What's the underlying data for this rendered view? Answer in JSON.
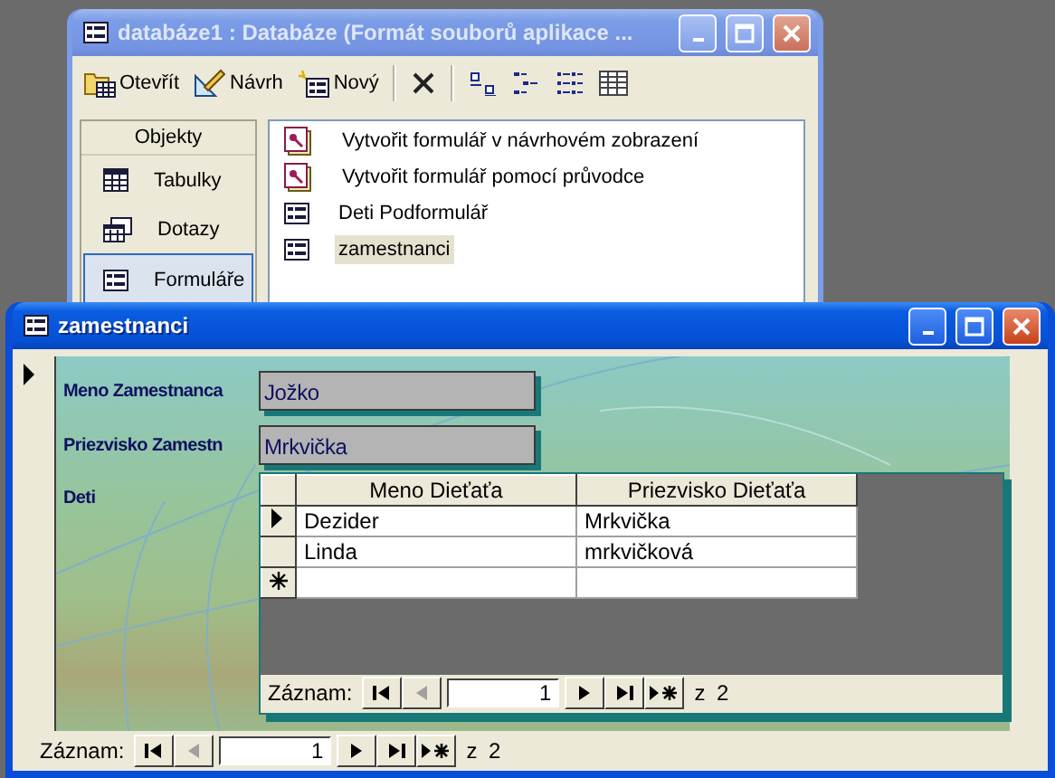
{
  "db_window": {
    "title": "databáze1 : Databáze (Formát souborů aplikace ...",
    "active": false,
    "toolbar": [
      {
        "kind": "open",
        "label": "Otevřít"
      },
      {
        "kind": "design",
        "label": "Návrh"
      },
      {
        "kind": "new",
        "label": "Nový"
      },
      {
        "kind": "delete"
      },
      {
        "kind": "large-icons"
      },
      {
        "kind": "small-icons"
      },
      {
        "kind": "list"
      },
      {
        "kind": "details"
      }
    ],
    "objects_header": "Objekty",
    "objects": [
      {
        "kind": "table",
        "label": "Tabulky",
        "selected": false
      },
      {
        "kind": "query",
        "label": "Dotazy",
        "selected": false
      },
      {
        "kind": "form",
        "label": "Formuláře",
        "selected": true
      }
    ],
    "items": [
      {
        "kind": "wizard",
        "label": "Vytvořit formulář v návrhovém zobrazení",
        "selected": false
      },
      {
        "kind": "wizard",
        "label": "Vytvořit formulář pomocí průvodce",
        "selected": false
      },
      {
        "kind": "form",
        "label": "Deti Podformulář",
        "selected": false
      },
      {
        "kind": "form",
        "label": "zamestnanci",
        "selected": true
      }
    ]
  },
  "form_window": {
    "title": "zamestnanci",
    "active": true,
    "fields": [
      {
        "label": "Meno Zamestnanca",
        "value": "Jožko"
      },
      {
        "label": "Priezvisko Zamestn",
        "value": "Mrkvička"
      }
    ],
    "subform": {
      "label": "Deti",
      "columns": [
        "Meno Dieťaťa",
        "Priezvisko Dieťaťa"
      ],
      "rows": [
        {
          "kind": "current",
          "cells": [
            "Dezider",
            "Mrkvička"
          ]
        },
        {
          "kind": "plain",
          "cells": [
            "Linda",
            "mrkvičková"
          ]
        },
        {
          "kind": "new"
        }
      ],
      "navigation": {
        "label": "Záznam:",
        "of": "z 2",
        "controls": [
          {
            "kind": "first",
            "disabled": false
          },
          {
            "kind": "prev",
            "disabled": true
          },
          {
            "kind": "record",
            "value": "1"
          },
          {
            "kind": "next",
            "disabled": false
          },
          {
            "kind": "last",
            "disabled": false
          },
          {
            "kind": "new",
            "disabled": false
          }
        ]
      }
    },
    "navigation": {
      "label": "Záznam:",
      "of": "z 2",
      "controls": [
        {
          "kind": "first",
          "disabled": false
        },
        {
          "kind": "prev",
          "disabled": true
        },
        {
          "kind": "record",
          "value": "1"
        },
        {
          "kind": "next",
          "disabled": false
        },
        {
          "kind": "last",
          "disabled": false
        },
        {
          "kind": "new",
          "disabled": false
        }
      ]
    }
  }
}
